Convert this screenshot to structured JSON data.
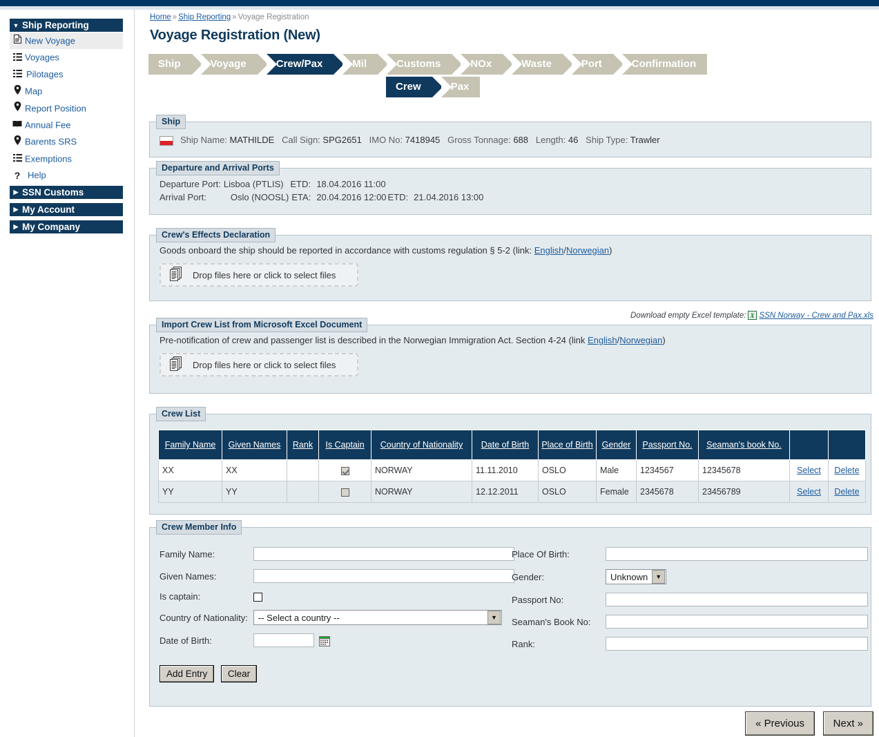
{
  "sidebar": {
    "groups": [
      {
        "label": "Ship Reporting",
        "expanded": true,
        "items": [
          {
            "label": "New Voyage",
            "icon": "document-icon",
            "active": true
          },
          {
            "label": "Voyages",
            "icon": "list-icon",
            "active": false
          },
          {
            "label": "Pilotages",
            "icon": "list-icon",
            "active": false
          },
          {
            "label": "Map",
            "icon": "map-pin-icon",
            "active": false
          },
          {
            "label": "Report Position",
            "icon": "map-pin-icon",
            "active": false
          },
          {
            "label": "Annual Fee",
            "icon": "book-icon",
            "active": false
          },
          {
            "label": "Barents SRS",
            "icon": "map-pin-icon",
            "active": false
          },
          {
            "label": "Exemptions",
            "icon": "list-icon",
            "active": false
          },
          {
            "label": "Help",
            "icon": "question-icon",
            "active": false
          }
        ]
      },
      {
        "label": "SSN Customs",
        "expanded": false,
        "items": []
      },
      {
        "label": "My Account",
        "expanded": false,
        "items": []
      },
      {
        "label": "My Company",
        "expanded": false,
        "items": []
      }
    ]
  },
  "breadcrumb": {
    "home": "Home",
    "section": "Ship Reporting",
    "current": "Voyage Registration",
    "separator": "»"
  },
  "page_title": "Voyage Registration (New)",
  "wizard": {
    "main": [
      {
        "label": "Ship",
        "active": false
      },
      {
        "label": "Voyage",
        "active": false
      },
      {
        "label": "Crew/Pax",
        "active": true
      },
      {
        "label": "Mil",
        "active": false
      },
      {
        "label": "Customs",
        "active": false
      },
      {
        "label": "NOx",
        "active": false
      },
      {
        "label": "Waste",
        "active": false
      },
      {
        "label": "Port",
        "active": false
      },
      {
        "label": "Confirmation",
        "active": false
      }
    ],
    "sub": [
      {
        "label": "Crew",
        "active": true
      },
      {
        "label": "Pax",
        "active": false
      }
    ]
  },
  "ship": {
    "legend": "Ship",
    "flag_icon": "poland-flag-icon",
    "fields": [
      {
        "label": "Ship Name:",
        "value": "MATHILDE"
      },
      {
        "label": "Call Sign:",
        "value": "SPG2651"
      },
      {
        "label": "IMO No:",
        "value": "7418945"
      },
      {
        "label": "Gross Tonnage:",
        "value": "688"
      },
      {
        "label": "Length:",
        "value": "46"
      },
      {
        "label": "Ship Type:",
        "value": "Trawler"
      }
    ]
  },
  "ports": {
    "legend": "Departure and Arrival Ports",
    "departure": {
      "label": "Departure Port:",
      "port": "Lisboa (PTLIS)",
      "etd_label": "ETD:",
      "etd": "18.04.2016 11:00"
    },
    "arrival": {
      "label": "Arrival Port:",
      "port": "Oslo (NOOSL)",
      "eta_label": "ETA:",
      "eta": "20.04.2016 12:00",
      "etd_label": "ETD:",
      "etd": "21.04.2016 13:00"
    }
  },
  "effects": {
    "legend": "Crew's Effects Declaration",
    "text_before": "Goods onboard the ship should be reported in accordance with customs regulation § 5-2 (link: ",
    "link_en": "English",
    "link_slash": "/",
    "link_no": "Norwegian",
    "text_after": ")",
    "dropzone_text": "Drop files here or click to select files"
  },
  "excel_template": {
    "label": "Download empty Excel template:",
    "icon": "excel-icon",
    "link": "SSN Norway - Crew and Pax.xls"
  },
  "import": {
    "legend": "Import Crew List from Microsoft Excel Document",
    "text_before": "Pre-notification of crew and passenger list is described in the Norwegian Immigration Act. Section 4-24 (link ",
    "link_en": "English",
    "link_slash": "/",
    "link_no": "Norwegian",
    "text_after": ")",
    "dropzone_text": "Drop files here or click to select files"
  },
  "crew_list": {
    "legend": "Crew List",
    "columns": [
      {
        "label": "Family Name",
        "sortable": true
      },
      {
        "label": "Given Names",
        "sortable": true
      },
      {
        "label": "Rank",
        "sortable": true
      },
      {
        "label": "Is Captain",
        "sortable": true
      },
      {
        "label": "Country of Nationality",
        "sortable": true
      },
      {
        "label": "Date of Birth",
        "sortable": true
      },
      {
        "label": "Place of Birth",
        "sortable": true
      },
      {
        "label": "Gender",
        "sortable": true
      },
      {
        "label": "Passport No.",
        "sortable": true
      },
      {
        "label": "Seaman's book No.",
        "sortable": true
      },
      {
        "label": "",
        "sortable": false
      },
      {
        "label": "",
        "sortable": false
      }
    ],
    "rows": [
      {
        "family_name": "XX",
        "given_names": "XX",
        "rank": "",
        "is_captain": true,
        "country": "NORWAY",
        "date_of_birth": "11.11.2010",
        "place_of_birth": "OSLO",
        "gender": "Male",
        "passport_no": "1234567",
        "seamans_book_no": "12345678",
        "select_label": "Select",
        "delete_label": "Delete"
      },
      {
        "family_name": "YY",
        "given_names": "YY",
        "rank": "",
        "is_captain": false,
        "country": "NORWAY",
        "date_of_birth": "12.12.2011",
        "place_of_birth": "OSLO",
        "gender": "Female",
        "passport_no": "2345678",
        "seamans_book_no": "23456789",
        "select_label": "Select",
        "delete_label": "Delete"
      }
    ]
  },
  "crew_member_info": {
    "legend": "Crew Member Info",
    "left": {
      "family_name_label": "Family Name:",
      "family_name_value": "",
      "given_names_label": "Given Names:",
      "given_names_value": "",
      "is_captain_label": "Is captain:",
      "is_captain_checked": false,
      "country_label": "Country of Nationality:",
      "country_value": "-- Select a country --",
      "dob_label": "Date of Birth:",
      "dob_value": "",
      "calendar_icon": "calendar-icon"
    },
    "right": {
      "place_of_birth_label": "Place Of Birth:",
      "place_of_birth_value": "",
      "gender_label": "Gender:",
      "gender_value": "Unknown",
      "passport_label": "Passport No:",
      "passport_value": "",
      "seamans_book_label": "Seaman's Book No:",
      "seamans_book_value": "",
      "rank_label": "Rank:",
      "rank_value": ""
    },
    "add_entry_label": "Add Entry",
    "clear_label": "Clear"
  },
  "footer_nav": {
    "previous_label": "« Previous",
    "next_label": "Next »"
  },
  "colors": {
    "brand_navy": "#103a5d",
    "topbar": "#003764",
    "wizard_inactive": "#c6c3b2",
    "panel_bg": "#e4ebef",
    "link": "#1d5c9e"
  }
}
